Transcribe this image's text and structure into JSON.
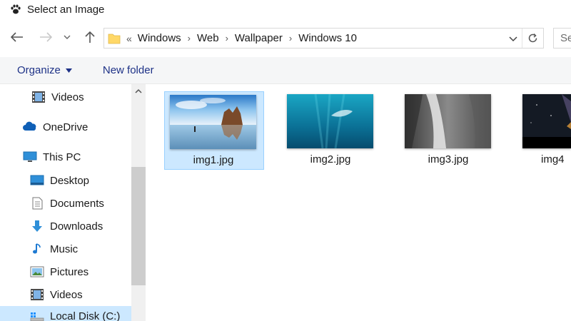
{
  "window": {
    "title": "Select an Image",
    "icon": "paw-icon"
  },
  "nav": {
    "back": "back-arrow-icon",
    "forward": "forward-arrow-icon",
    "recent": "chevron-down-icon",
    "up": "up-arrow-icon"
  },
  "address": {
    "lead": "«",
    "crumbs": [
      "Windows",
      "Web",
      "Wallpaper",
      "Windows 10"
    ]
  },
  "search": {
    "placeholder": "Se"
  },
  "toolbar": {
    "organize": "Organize",
    "new_folder": "New folder"
  },
  "sidebar": {
    "items": [
      {
        "label": "Videos",
        "icon": "video-icon",
        "level": 2
      },
      {
        "label": "OneDrive",
        "icon": "cloud-icon",
        "level": 1
      },
      {
        "label": "This PC",
        "icon": "computer-icon",
        "level": 1
      },
      {
        "label": "Desktop",
        "icon": "desktop-icon",
        "level": 2
      },
      {
        "label": "Documents",
        "icon": "document-icon",
        "level": 2
      },
      {
        "label": "Downloads",
        "icon": "download-icon",
        "level": 2
      },
      {
        "label": "Music",
        "icon": "music-icon",
        "level": 2
      },
      {
        "label": "Pictures",
        "icon": "pictures-icon",
        "level": 2
      },
      {
        "label": "Videos",
        "icon": "video-icon",
        "level": 2
      },
      {
        "label": "Local Disk (C:)",
        "icon": "drive-icon",
        "level": 2,
        "selected": true
      }
    ]
  },
  "files": [
    {
      "name": "img1.jpg",
      "selected": true
    },
    {
      "name": "img2.jpg",
      "selected": false
    },
    {
      "name": "img3.jpg",
      "selected": false
    },
    {
      "name": "img4",
      "selected": false
    }
  ],
  "colors": {
    "accent": "#1e3287",
    "selection": "#cce8ff",
    "selection_border": "#99d1ff",
    "folder": "#ffd867"
  }
}
